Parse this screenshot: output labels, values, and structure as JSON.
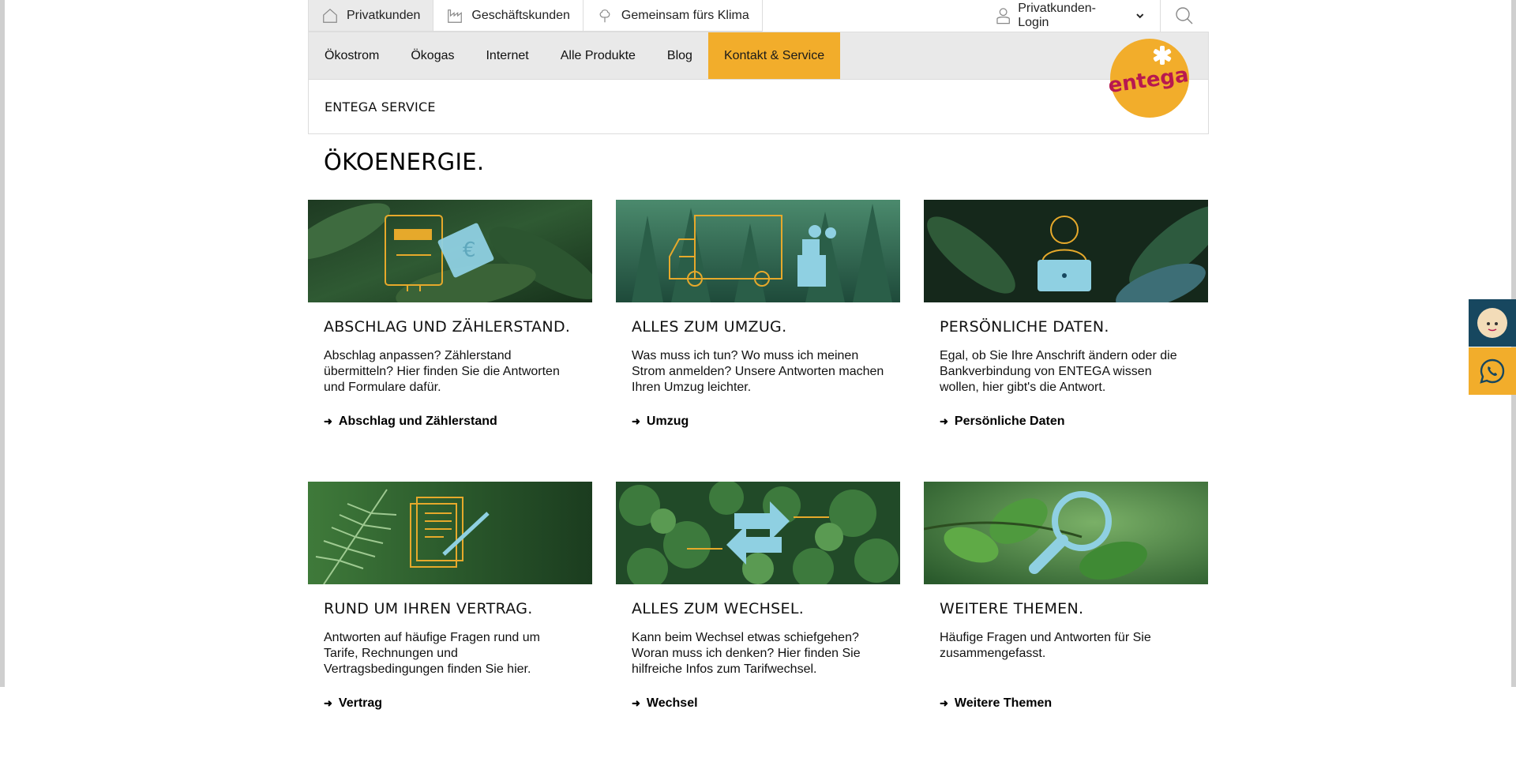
{
  "segments": [
    {
      "label": "Privatkunden",
      "icon": "home-icon",
      "active": true
    },
    {
      "label": "Geschäftskunden",
      "icon": "factory-icon",
      "active": false
    },
    {
      "label": "Gemeinsam fürs Klima",
      "icon": "tree-icon",
      "active": false
    }
  ],
  "login": {
    "label": "Privatkunden-Login",
    "icon": "user-icon"
  },
  "nav": [
    {
      "label": "Ökostrom"
    },
    {
      "label": "Ökogas"
    },
    {
      "label": "Internet"
    },
    {
      "label": "Alle Produkte"
    },
    {
      "label": "Blog"
    },
    {
      "label": "Kontakt & Service",
      "active": true
    }
  ],
  "subnav": {
    "label": "ENTEGA SERVICE"
  },
  "logo": {
    "text": "entega",
    "color": "#f2ad2b",
    "text_color": "#b8194f"
  },
  "page_title": "ÖKOENERGIE.",
  "cards": [
    {
      "title": "ABSCHLAG UND ZÄHLERSTAND.",
      "text": "Abschlag anpassen? Zählerstand übermitteln? Hier finden Sie die Antworten und Formulare dafür.",
      "link": "Abschlag und Zählerstand",
      "icon": "meter-money-icon"
    },
    {
      "title": "ALLES ZUM UMZUG.",
      "text": "Was muss ich tun? Wo muss ich meinen Strom anmelden? Unsere Antworten machen Ihren Umzug leichter.",
      "link": "Umzug",
      "icon": "moving-truck-icon"
    },
    {
      "title": "PERSÖNLICHE DATEN.",
      "text": "Egal, ob Sie Ihre Anschrift ändern oder die Bankverbindung von ENTEGA wissen wollen, hier gibt's die Antwort.",
      "link": "Persönliche Daten",
      "icon": "person-laptop-icon"
    },
    {
      "title": "RUND UM IHREN VERTRAG.",
      "text": "Antworten auf häufige Fragen rund um Tarife, Rechnungen und Vertragsbedingungen finden Sie hier.",
      "link": "Vertrag",
      "icon": "contract-icon"
    },
    {
      "title": "ALLES ZUM WECHSEL.",
      "text": "Kann beim Wechsel etwas schiefgehen? Woran muss ich denken? Hier finden Sie hilfreiche Infos zum Tarifwechsel.",
      "link": "Wechsel",
      "icon": "switch-arrows-icon"
    },
    {
      "title": "WEITERE THEMEN.",
      "text": "Häufige Fragen und Antworten für Sie zusammengefasst.",
      "link": "Weitere Themen",
      "icon": "magnifier-icon"
    }
  ],
  "colors": {
    "accent": "#f2ad2b",
    "dark_teal": "#17475f",
    "icon_light_blue": "#8fd0e2",
    "icon_gold": "#e6a92b"
  },
  "side_widgets": [
    {
      "name": "chat-agent",
      "icon": "agent-avatar-icon"
    },
    {
      "name": "whatsapp",
      "icon": "whatsapp-icon"
    }
  ]
}
